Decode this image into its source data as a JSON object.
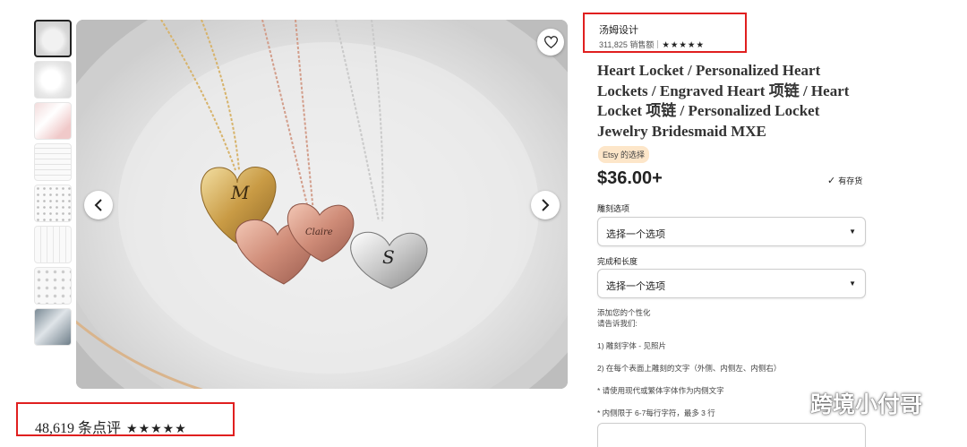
{
  "listing": {
    "shop_name": "汤姆设计",
    "sales": "311,825 销售额",
    "shop_rating_stars": "★★★★★",
    "title": "Heart Locket / Personalized Heart Lockets / Engraved Heart 项链 / Heart Locket 项链 / Personalized Locket Jewelry Bridesmaid MXE",
    "badge": "Etsy 的选择",
    "price": "$36.00+",
    "stock": "有存货",
    "reviews_count": "48,619 条点评",
    "reviews_stars": "★★★★★"
  },
  "image": {
    "engravings": [
      "M",
      "Claire",
      "S"
    ]
  },
  "options": [
    {
      "label": "雕刻选项",
      "placeholder": "选择一个选项"
    },
    {
      "label": "完成和长度",
      "placeholder": "选择一个选项"
    }
  ],
  "personalization": {
    "title": "添加您的个性化",
    "lines": [
      "请告诉我们:",
      "1) 雕刻字体 - 见照片",
      "2) 在每个表面上雕刻的文字（外侧、内侧左、内侧右）",
      "* 请使用现代或繁体字体作为内侧文字",
      "* 内侧限于 6-7每行字符，最多 3 行"
    ]
  },
  "watermark": {
    "text": "跨境小付哥",
    "icon": "wechat-icon"
  },
  "colors": {
    "highlight_box": "#e01f1f",
    "badge_bg": "#fde6c9"
  }
}
